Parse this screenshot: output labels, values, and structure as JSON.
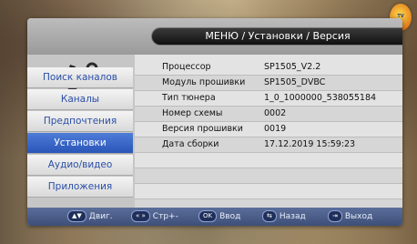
{
  "title": "МЕНЮ / Установки / Версия",
  "sidebar": {
    "items": [
      {
        "label": "Поиск каналов",
        "active": false
      },
      {
        "label": "Каналы",
        "active": false
      },
      {
        "label": "Предпочтения",
        "active": false
      },
      {
        "label": "Установки",
        "active": true
      },
      {
        "label": "Аудио/видео",
        "active": false
      },
      {
        "label": "Приложения",
        "active": false
      }
    ]
  },
  "info": [
    {
      "label": "Процессор",
      "value": "SP1505_V2.2"
    },
    {
      "label": "Модуль прошивки",
      "value": "SP1505_DVBC"
    },
    {
      "label": "Тип тюнера",
      "value": "1_0_1000000_538055184"
    },
    {
      "label": "Номер схемы",
      "value": "0002"
    },
    {
      "label": "Версия прошивки",
      "value": "0019"
    },
    {
      "label": "Дата сборки",
      "value": "17.12.2019 15:59:23"
    }
  ],
  "footer": [
    {
      "key": "▲▼",
      "label": "Двиг."
    },
    {
      "key": "« »",
      "label": "Стр+-"
    },
    {
      "key": "OK",
      "label": "Ввод"
    },
    {
      "key": "⇆",
      "label": "Назад"
    },
    {
      "key": "⇥",
      "label": "Выход"
    }
  ],
  "colors": {
    "accent": "#2a55b8",
    "footer": "#3d4f78",
    "panel": "#d8d8d8"
  },
  "icons": {
    "settings": "tools-icon"
  }
}
